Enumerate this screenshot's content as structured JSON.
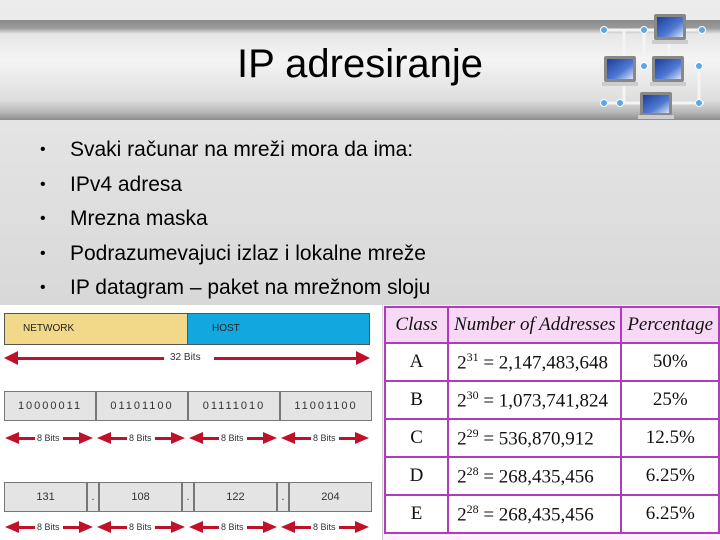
{
  "slide": {
    "title": "IP adresiranje",
    "icon": "network-topology-icon",
    "bullets": [
      "Svaki računar na mreži mora da ima:",
      "IPv4 adresa",
      "Mrezna maska",
      "Podrazumevajuci izlaz i lokalne mreže",
      "IP datagram – paket na mrežnom sloju"
    ]
  },
  "diagram": {
    "network_label": "NETWORK",
    "host_label": "HOST",
    "total_bits_label": "32 Bits",
    "binary_octets": [
      "10000011",
      "01101100",
      "01111010",
      "11001100"
    ],
    "octet_bits_label": "8 Bits",
    "decimal_octets": [
      "131",
      "108",
      "122",
      "204"
    ],
    "separator": ".",
    "colors": {
      "network": "#f2d98a",
      "host": "#12a8df",
      "arrow": "#c0102a"
    }
  },
  "class_table": {
    "headers": [
      "Class",
      "Number of Addresses",
      "Percentage"
    ],
    "rows": [
      {
        "class": "A",
        "base": "2",
        "exp": "31",
        "value": " = 2,147,483,648",
        "percentage": "50%"
      },
      {
        "class": "B",
        "base": "2",
        "exp": "30",
        "value": " = 1,073,741,824",
        "percentage": "25%"
      },
      {
        "class": "C",
        "base": "2",
        "exp": "29",
        "value": " = 536,870,912",
        "percentage": "12.5%"
      },
      {
        "class": "D",
        "base": "2",
        "exp": "28",
        "value": " = 268,435,456",
        "percentage": "6.25%"
      },
      {
        "class": "E",
        "base": "2",
        "exp": "28",
        "value": " = 268,435,456",
        "percentage": "6.25%"
      }
    ],
    "border_color": "#b13bbd"
  }
}
